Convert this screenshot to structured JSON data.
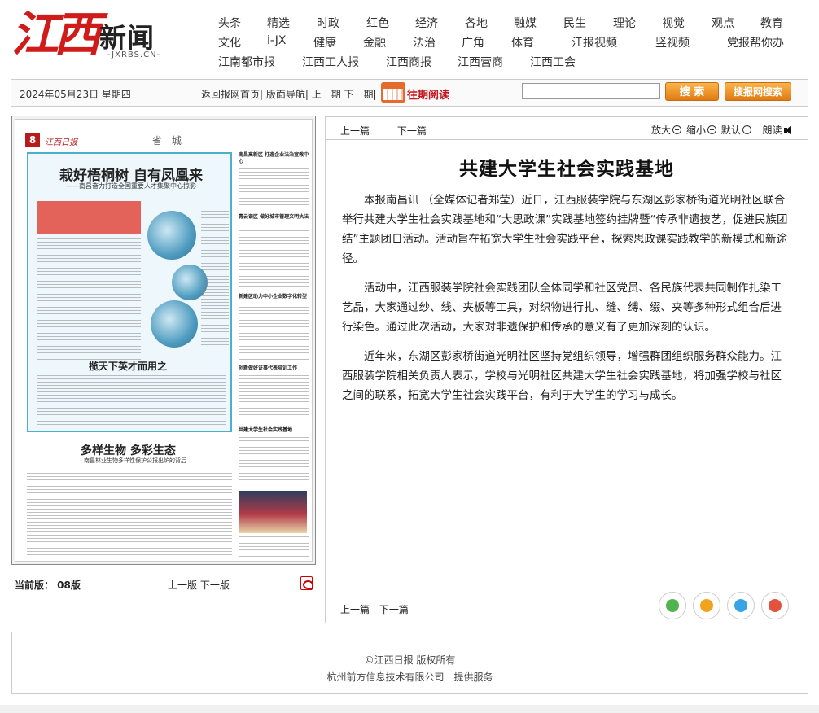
{
  "logo": {
    "big": "江西",
    "small": "新闻",
    "url": "-JXRBS.CN-"
  },
  "nav": {
    "row1": [
      "头条",
      "精选",
      "时政",
      "红色",
      "经济",
      "各地",
      "融媒",
      "民生",
      "理论",
      "视觉",
      "观点",
      "教育"
    ],
    "row2": [
      "文化",
      "i-JX",
      "健康",
      "金融",
      "法治",
      "广角",
      "体育",
      "江报视频",
      "竖视频",
      "党报帮你办"
    ],
    "row3": [
      "江南都市报",
      "江西工人报",
      "江西商报",
      "江西营商",
      "江西工会"
    ]
  },
  "toolbar": {
    "date": "2024年05月23日 星期四",
    "links": "返回报网首页| 版面导航| 上一期 下一期|",
    "past_issues": "往期阅读",
    "search_label": "搜 索",
    "site_search_label": "搜报网搜索"
  },
  "newspaper": {
    "page_num": "8",
    "brand": "江西日报",
    "section": "省 城",
    "headline": "栽好梧桐树 自有凤凰来",
    "subheadline": "——南昌奋力打造全国重要人才集聚中心掠影",
    "sub2": "揽天下英才而用之",
    "lower_headline": "多样生物 多彩生态",
    "lower_sub": "——南昌林业生物多样性保护公报出炉的背后",
    "side": [
      "南昌高新区 打造企业法治宣教中心",
      "青云谱区 做好城市管理文明执法",
      "新建区助力中小企业数字化转型",
      "创新做好证事代表培训工作",
      "共建大学生社会实践基地"
    ]
  },
  "left_bottom": {
    "current_page": "当前版： 08版",
    "prev_next": "上一版 下一版"
  },
  "article": {
    "prev": "上一篇",
    "next": "下一篇",
    "zoom_in": "放大",
    "zoom_out": "缩小",
    "default": "默认",
    "read_aloud": "朗读",
    "title": "共建大学生社会实践基地",
    "paragraphs": [
      "本报南昌讯 （全媒体记者郑莹）近日，江西服装学院与东湖区彭家桥街道光明社区联合举行共建大学生社会实践基地和“大思政课”实践基地签约挂牌暨“传承非遗技艺，促进民族团结”主题团日活动。活动旨在拓宽大学生社会实践平台，探索思政课实践教学的新模式和新途径。",
      "活动中，江西服装学院社会实践团队全体同学和社区党员、各民族代表共同制作扎染工艺品，大家通过纱、线、夹板等工具，对织物进行扎、缝、缚、缀、夹等多种形式组合后进行染色。通过此次活动，大家对非遗保护和传承的意义有了更加深刻的认识。",
      "近年来，东湖区彭家桥街道光明社区坚持党组织领导，增强群团组织服务群众能力。江西服装学院相关负责人表示，学校与光明社区共建大学生社会实践基地，将加强学校与社区之间的联系，拓宽大学生社会实践平台，有利于大学生的学习与成长。"
    ]
  },
  "footer": {
    "copyright": "©江西日报 版权所有",
    "service": "杭州前方信息技术有限公司　提供服务"
  }
}
